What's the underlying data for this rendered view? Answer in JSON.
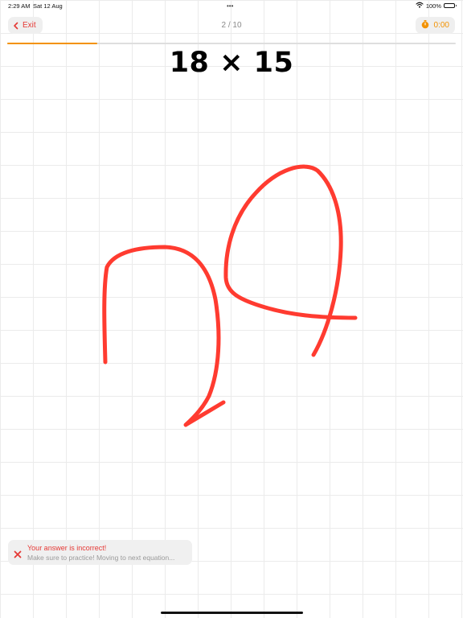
{
  "status_bar": {
    "time": "2:29 AM",
    "date": "Sat 12 Aug",
    "multitask_dots": "•••",
    "battery_text": "100%",
    "icons": [
      "wifi-icon",
      "battery-icon"
    ]
  },
  "toolbar": {
    "exit_label": "Exit",
    "exit_icon": "chevron-left-icon",
    "progress_label": "2 / 10",
    "timer_label": "0:00",
    "timer_icon": "stopwatch-icon",
    "progress_fraction": 0.2
  },
  "question": {
    "equation": "18 × 15"
  },
  "feedback": {
    "icon": "close-icon",
    "title": "Your answer is incorrect!",
    "message": "Make sure to practice! Moving to next equation..."
  },
  "colors": {
    "accent_orange": "#f39200",
    "error_red": "#e53935",
    "ink_red": "#ff3b30",
    "grid": "#ebebeb"
  }
}
